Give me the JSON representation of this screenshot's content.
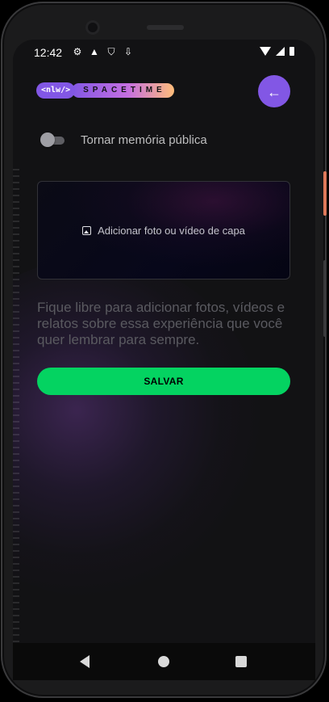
{
  "status_bar": {
    "time": "12:42",
    "left_icons": [
      "gear-icon",
      "android-icon",
      "shield-icon",
      "download-icon"
    ],
    "right_icons": [
      "wifi-icon",
      "signal-icon",
      "battery-icon"
    ]
  },
  "header": {
    "logo_nlw": "<nlw/>",
    "logo_spacetime": "SPACETIME",
    "back_icon": "arrow-left-icon"
  },
  "form": {
    "public_toggle": {
      "label": "Tornar memória pública",
      "checked": false
    },
    "cover_button": {
      "label": "Adicionar foto ou vídeo de capa",
      "icon": "image-icon"
    },
    "helper_text": "Fique libre para adicionar fotos, vídeos e relatos sobre essa experiência que você quer lembrar para sempre.",
    "save_button": "SALVAR"
  },
  "colors": {
    "accent_purple": "#8257e5",
    "save_green": "#04d361",
    "background": "#121214"
  },
  "nav_bar": [
    "back-triangle-icon",
    "home-circle-icon",
    "recents-square-icon"
  ]
}
